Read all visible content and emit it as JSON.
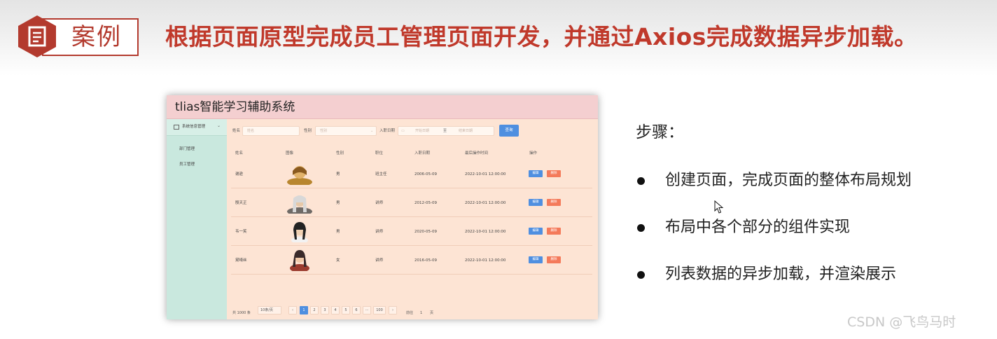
{
  "slide": {
    "tag": "案例",
    "title": "根据页面原型完成员工管理页面开发，并通过Axios完成数据异步加载。",
    "steps_title": "步骤：",
    "steps": [
      "创建页面，完成页面的整体布局规划",
      "布局中各个部分的组件实现",
      "列表数据的异步加载，并渲染展示"
    ],
    "watermark": "CSDN @飞鸟马时"
  },
  "app": {
    "title": "tlias智能学习辅助系统",
    "sidebar": {
      "group_label": "系统信息管理",
      "items": [
        "部门管理",
        "员工管理"
      ]
    },
    "search": {
      "name_label": "姓名",
      "name_placeholder": "姓名",
      "gender_label": "性别",
      "gender_placeholder": "性别",
      "date_label": "入职日期",
      "start_placeholder": "开始日期",
      "range_sep": "至",
      "end_placeholder": "结束日期",
      "query_button": "查询"
    },
    "table": {
      "headers": [
        "姓名",
        "图像",
        "性别",
        "职位",
        "入职日期",
        "最后操作时间",
        "操作"
      ],
      "rows": [
        {
          "name": "谢逊",
          "avatar": "avatar-1",
          "gender": "男",
          "job": "班主任",
          "entry_date": "2006-05-09",
          "update_time": "2022-10-01 12:00:00"
        },
        {
          "name": "殷天正",
          "avatar": "avatar-2",
          "gender": "男",
          "job": "讲师",
          "entry_date": "2012-05-09",
          "update_time": "2022-10-01 12:00:00"
        },
        {
          "name": "韦一笑",
          "avatar": "avatar-3",
          "gender": "男",
          "job": "讲师",
          "entry_date": "2020-05-09",
          "update_time": "2022-10-01 12:00:00"
        },
        {
          "name": "黛绮丝",
          "avatar": "avatar-4",
          "gender": "女",
          "job": "讲师",
          "entry_date": "2016-05-09",
          "update_time": "2022-10-01 12:00:00"
        }
      ],
      "edit_label": "编辑",
      "delete_label": "删除"
    },
    "pagination": {
      "total": "共 1000 条",
      "page_size": "10条/页",
      "pages": [
        "1",
        "2",
        "3",
        "4",
        "5",
        "6",
        "···",
        "100"
      ],
      "current_page": "1",
      "goto_label": "前往",
      "goto_value": "1",
      "goto_suffix": "页"
    }
  },
  "colors": {
    "brand_red": "#c0392b",
    "app_header": "#f4cfd0",
    "app_body": "#fde4d4",
    "sidebar": "#c9e8de",
    "primary_blue": "#4f8fe0",
    "danger": "#f47a5a"
  }
}
